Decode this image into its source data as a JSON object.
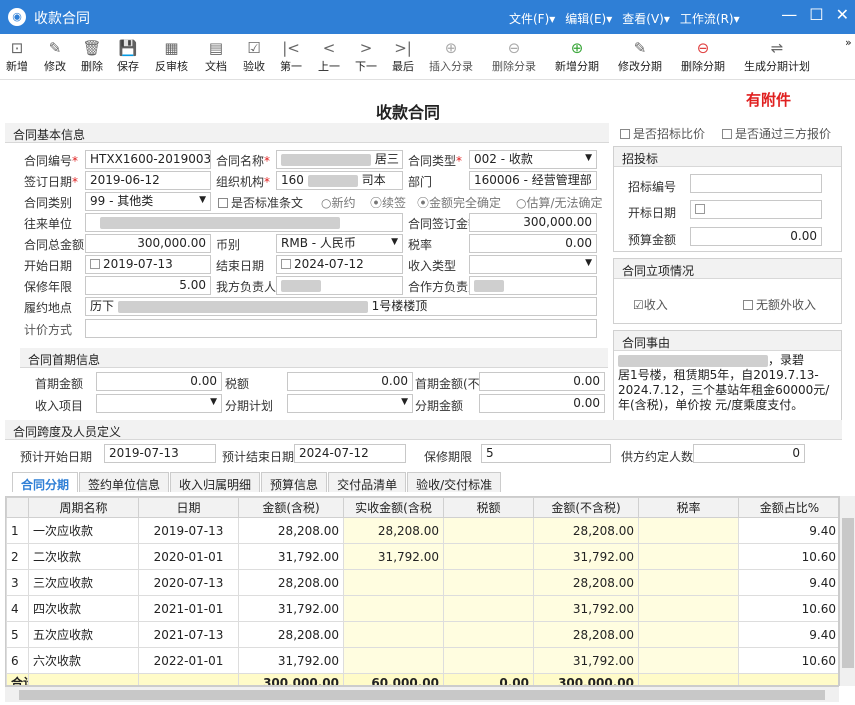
{
  "app": {
    "title": "收款合同",
    "logo": "◉"
  },
  "menus": [
    "文件(F)▾",
    "编辑(E)▾",
    "查看(V)▾",
    "工作流(R)▾"
  ],
  "toolbar": {
    "new": "新增",
    "edit": "修改",
    "delete": "删除",
    "save": "保存",
    "unaudit": "反审核",
    "document": "文档",
    "check": "验收",
    "first": "第一",
    "prev": "上一",
    "next": "下一",
    "last": "最后",
    "insert_entry": "插入分录",
    "delete_entry": "删除分录",
    "add_installment": "新增分期",
    "edit_installment": "修改分期",
    "delete_installment": "删除分期",
    "generate_plan": "生成分期计划",
    "more": "»"
  },
  "page_title": "收款合同",
  "attachment_flag": "有附件",
  "basic": {
    "section": "合同基本信息",
    "contract_no_label": "合同编号",
    "contract_no": "HTXX1600-2019003",
    "contract_name_label": "合同名称",
    "contract_name_suffix": "居三",
    "contract_type_label": "合同类型",
    "contract_type": "002 - 收款",
    "sign_date_label": "签订日期",
    "sign_date": "2019-06-12",
    "org_label": "组织机构",
    "org_prefix": "160",
    "org_suffix": "司本",
    "dept_label": "部门",
    "dept": "160006 - 经营管理部",
    "category_label": "合同类别",
    "category": "99 - 其他类",
    "standard_label": "是否标准条文",
    "radio_new": "新约",
    "radio_renew": "续签",
    "radio_full": "金额完全确定",
    "radio_est": "估算/无法确定",
    "partner_label": "往来单位",
    "sign_amount_label": "合同签订金额",
    "sign_amount": "300,000.00",
    "total_label": "合同总金额",
    "total": "300,000.00",
    "currency_label": "币别",
    "currency": "RMB - 人民币",
    "tax_rate_label": "税率",
    "tax_rate": "0.00",
    "start_label": "开始日期",
    "start": "2019-07-13",
    "end_label": "结束日期",
    "end": "2024-07-12",
    "income_type_label": "收入类型",
    "warranty_label": "保修年限",
    "warranty": "5.00",
    "our_person_label": "我方负责人",
    "partner_person_label": "合作方负责人",
    "location_label": "履约地点",
    "location_prefix": "历下",
    "location_suffix": "1号楼楼顶",
    "pricing_label": "计价方式"
  },
  "right": {
    "bid_compare": "是否招标比价",
    "third_party": "是否通过三方报价",
    "bid_section": "招投标",
    "bid_no_label": "招标编号",
    "bid_date_label": "开标日期",
    "budget_label": "预算金额",
    "budget": "0.00",
    "setup_section": "合同立项情况",
    "income_cb": "收入",
    "no_extra_cb": "无额外收入",
    "reason_section": "合同事由",
    "reason_line1": "，录碧",
    "reason_line2": "居1号楼，租赁期5年，自2019.7.13-",
    "reason_line3": "2024.7.12，三个基站年租金60000元/",
    "reason_line4": "年(含税)，单价按    元/度乘度支付。"
  },
  "first_period": {
    "section": "合同首期信息",
    "amount_label": "首期金额",
    "amount": "0.00",
    "tax_label": "税额",
    "tax": "0.00",
    "amount_notax_label": "首期金额(不含税)",
    "amount_notax": "0.00",
    "item_label": "收入项目",
    "plan_label": "分期计划",
    "period_amount_label": "分期金额",
    "period_amount": "0.00"
  },
  "span": {
    "section": "合同跨度及人员定义",
    "plan_start_label": "预计开始日期",
    "plan_start": "2019-07-13",
    "plan_end_label": "预计结束日期",
    "plan_end": "2024-07-12",
    "warranty_label": "保修期限",
    "warranty": "5",
    "supplier_count_label": "供方约定人数",
    "supplier_count": "0"
  },
  "tabs": [
    "合同分期",
    "签约单位信息",
    "收入归属明细",
    "预算信息",
    "交付品清单",
    "验收/交付标准"
  ],
  "grid": {
    "headers": [
      "",
      "周期名称",
      "日期",
      "金额(含税)",
      "实收金额(含税",
      "税额",
      "金额(不含税)",
      "税率",
      "金额占比%"
    ],
    "rows": [
      {
        "n": "1",
        "name": "一次应收款",
        "date": "2019-07-13",
        "amt": "28,208.00",
        "recv": "28,208.00",
        "tax": "",
        "notax": "28,208.00",
        "rate": "",
        "pct": "9.40"
      },
      {
        "n": "2",
        "name": "二次收款",
        "date": "2020-01-01",
        "amt": "31,792.00",
        "recv": "31,792.00",
        "tax": "",
        "notax": "31,792.00",
        "rate": "",
        "pct": "10.60"
      },
      {
        "n": "3",
        "name": "三次应收款",
        "date": "2020-07-13",
        "amt": "28,208.00",
        "recv": "",
        "tax": "",
        "notax": "28,208.00",
        "rate": "",
        "pct": "9.40"
      },
      {
        "n": "4",
        "name": "四次收款",
        "date": "2021-01-01",
        "amt": "31,792.00",
        "recv": "",
        "tax": "",
        "notax": "31,792.00",
        "rate": "",
        "pct": "10.60"
      },
      {
        "n": "5",
        "name": "五次应收款",
        "date": "2021-07-13",
        "amt": "28,208.00",
        "recv": "",
        "tax": "",
        "notax": "28,208.00",
        "rate": "",
        "pct": "9.40"
      },
      {
        "n": "6",
        "name": "六次收款",
        "date": "2022-01-01",
        "amt": "31,792.00",
        "recv": "",
        "tax": "",
        "notax": "31,792.00",
        "rate": "",
        "pct": "10.60"
      }
    ],
    "sum": {
      "label": "合计",
      "amt": "300,000.00",
      "recv": "60,000.00",
      "tax": "0.00",
      "notax": "300,000.00"
    }
  }
}
